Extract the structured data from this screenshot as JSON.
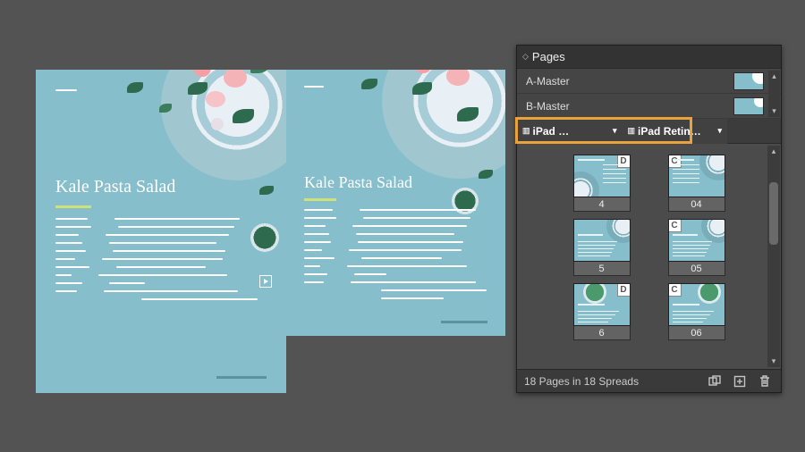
{
  "doc": {
    "title": "Kale Pasta Salad"
  },
  "panel": {
    "tab": "Pages",
    "masters": [
      {
        "name": "A-Master"
      },
      {
        "name": "B-Master"
      }
    ],
    "layouts": [
      {
        "label": "iPad …"
      },
      {
        "label": "iPad Retin…"
      }
    ],
    "columns": [
      {
        "master_letter": "D",
        "letter_side": "right",
        "pages": [
          "4",
          "5",
          "6"
        ]
      },
      {
        "master_letter": "C",
        "letter_side": "left",
        "pages": [
          "04",
          "05",
          "06"
        ]
      }
    ],
    "status": "18 Pages in 18 Spreads"
  }
}
